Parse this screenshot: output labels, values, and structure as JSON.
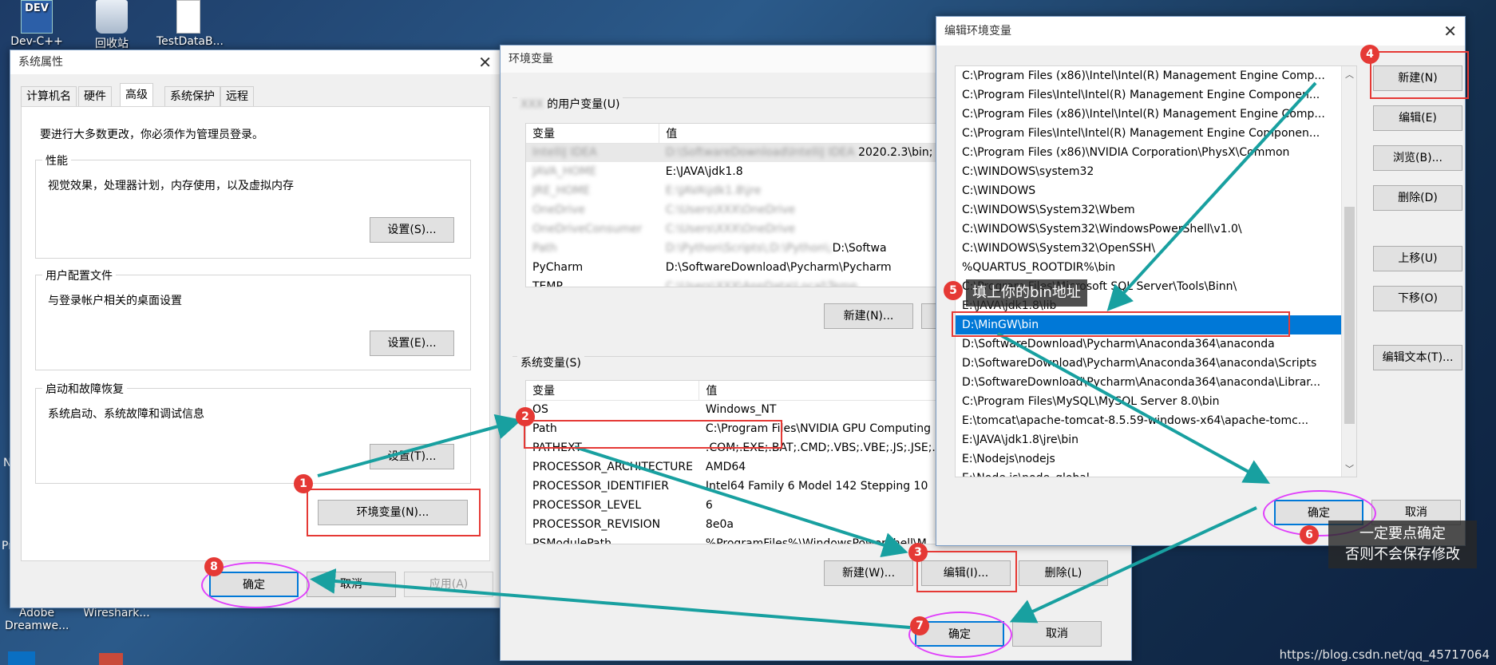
{
  "desktop": {
    "icons": [
      {
        "label": "Dev-C++",
        "badge": "DEV"
      },
      {
        "label": "回收站"
      },
      {
        "label": "TestDataB..."
      },
      {
        "label": "Adobe Dreamwe..."
      },
      {
        "label": "Wireshark..."
      }
    ],
    "edge_left_1": "N",
    "edge_left_2": "Pr"
  },
  "sys_props": {
    "title": "系统属性",
    "tabs": [
      "计算机名",
      "硬件",
      "高级",
      "系统保护",
      "远程"
    ],
    "active_tab": "高级",
    "admin_note": "要进行大多数更改，你必须作为管理员登录。",
    "perf": {
      "title": "性能",
      "desc": "视觉效果，处理器计划，内存使用，以及虚拟内存",
      "button": "设置(S)..."
    },
    "profile": {
      "title": "用户配置文件",
      "desc": "与登录帐户相关的桌面设置",
      "button": "设置(E)..."
    },
    "startup": {
      "title": "启动和故障恢复",
      "desc": "系统启动、系统故障和调试信息",
      "button": "设置(T)..."
    },
    "env_button": "环境变量(N)...",
    "ok": "确定",
    "cancel": "取消",
    "apply": "应用(A)"
  },
  "env_vars": {
    "title": "环境变量",
    "user_section": "的用户变量(U)",
    "user_name_blurred": "XXX",
    "col_var": "变量",
    "col_val": "值",
    "user_rows": [
      {
        "var": "IntelliJ IDEA",
        "val": "D:\\IntelliJ IDEA 2020.2.3\\bin;",
        "blur_var": true,
        "blur_val_prefix": "D:\\SoftwareDownload\\IntelliJ IDEA",
        "val_clear": "2020.2.3\\bin;"
      },
      {
        "var": "JAVA_HOME",
        "val": "E:\\JAVA\\jdk1.8",
        "blur_var": true
      },
      {
        "var": "JRE_HOME",
        "val": "E:\\JAVA\\jdk1.8\\jre",
        "blur_var": true
      },
      {
        "var": "OneDrive",
        "val": "C:\\Users\\XXX\\OneDrive",
        "blur_var": true
      },
      {
        "var": "OneDriveConsumer",
        "val": "C:\\Users\\XXX\\OneDrive",
        "blur_var": true
      },
      {
        "var": "Path",
        "val_blur": "D:\\Python\\Scripts\\;D:\\Python\\;",
        "val_clear": "D:\\Softwa",
        "blur_var": true
      },
      {
        "var": "PyCharm",
        "val": "D:\\SoftwareDownload\\Pycharm\\Pycharm",
        "blur_var": false
      },
      {
        "var": "TEMP",
        "val": "C:\\Users\\XXX\\AppData\\Local\\Temp",
        "blur_var": false
      }
    ],
    "user_new": "新建(N)...",
    "sys_section": "系统变量(S)",
    "sys_rows": [
      {
        "var": "OS",
        "val": "Windows_NT"
      },
      {
        "var": "Path",
        "val": "C:\\Program Files\\NVIDIA GPU Computing"
      },
      {
        "var": "PATHEXT",
        "val": ".COM;.EXE;.BAT;.CMD;.VBS;.VBE;.JS;.JSE;."
      },
      {
        "var": "PROCESSOR_ARCHITECTURE",
        "val": "AMD64"
      },
      {
        "var": "PROCESSOR_IDENTIFIER",
        "val": "Intel64 Family 6 Model 142 Stepping 10"
      },
      {
        "var": "PROCESSOR_LEVEL",
        "val": "6"
      },
      {
        "var": "PROCESSOR_REVISION",
        "val": "8e0a"
      },
      {
        "var": "PSModulePath",
        "val": "%ProgramFiles%\\WindowsPowerShell\\M"
      }
    ],
    "sys_new": "新建(W)...",
    "sys_edit": "编辑(I)...",
    "sys_delete": "删除(L)",
    "ok": "确定",
    "cancel": "取消"
  },
  "edit_env": {
    "title": "编辑环境变量",
    "items": [
      "C:\\Program Files (x86)\\Intel\\Intel(R) Management Engine Comp...",
      "C:\\Program Files\\Intel\\Intel(R) Management Engine Componen...",
      "C:\\Program Files (x86)\\Intel\\Intel(R) Management Engine Comp...",
      "C:\\Program Files\\Intel\\Intel(R) Management Engine Componen...",
      "C:\\Program Files (x86)\\NVIDIA Corporation\\PhysX\\Common",
      "C:\\WINDOWS\\system32",
      "C:\\WINDOWS",
      "C:\\WINDOWS\\System32\\Wbem",
      "C:\\WINDOWS\\System32\\WindowsPowerShell\\v1.0\\",
      "C:\\WINDOWS\\System32\\OpenSSH\\",
      "%QUARTUS_ROOTDIR%\\bin",
      "C:\\Program Files\\Microsoft SQL Server\\Tools\\Binn\\",
      "E:\\JAVA\\jdk1.8\\lib",
      "D:\\MinGW\\bin",
      "D:\\SoftwareDownload\\Pycharm\\Anaconda364\\anaconda",
      "D:\\SoftwareDownload\\Pycharm\\Anaconda364\\anaconda\\Scripts",
      "D:\\SoftwareDownload\\Pycharm\\Anaconda364\\anaconda\\Librar...",
      "C:\\Program Files\\MySQL\\MySQL Server 8.0\\bin",
      "E:\\tomcat\\apache-tomcat-8.5.59-windows-x64\\apache-tomc...",
      "E:\\JAVA\\jdk1.8\\jre\\bin",
      "E:\\Nodejs\\nodejs",
      "E:\\Node.js\\node_global"
    ],
    "selected_index": 13,
    "buttons": {
      "new": "新建(N)",
      "edit": "编辑(E)",
      "browse": "浏览(B)...",
      "delete": "删除(D)",
      "up": "上移(U)",
      "down": "下移(O)",
      "edit_text": "编辑文本(T)..."
    },
    "ok": "确定",
    "cancel": "取消"
  },
  "annotations": {
    "badges": [
      "1",
      "2",
      "3",
      "4",
      "5",
      "6",
      "7",
      "8"
    ],
    "note5": "填上你的bin地址",
    "note6_line1": "一定要点确定",
    "note6_line2": "否则不会保存修改",
    "colors": {
      "arrow": "#18a0a0",
      "box": "#e53935",
      "ellipse": "#e040fb"
    }
  },
  "watermark": "https://blog.csdn.net/qq_45717064"
}
